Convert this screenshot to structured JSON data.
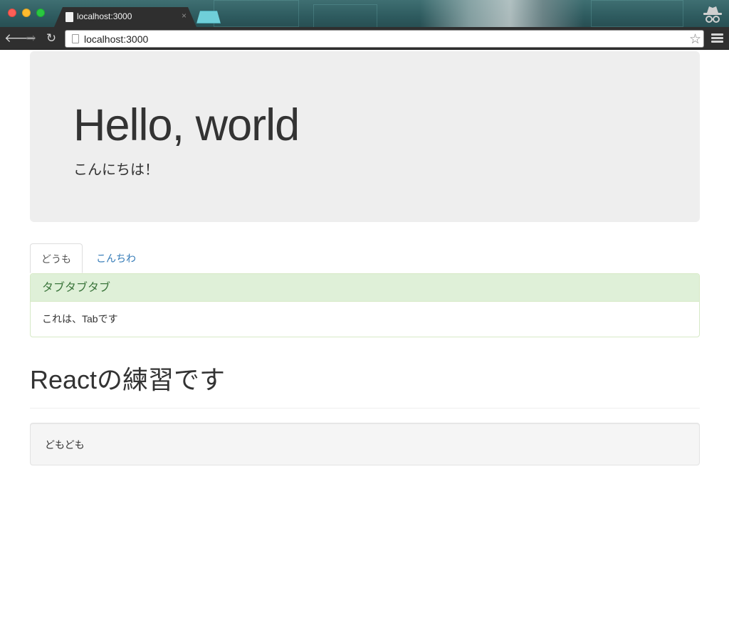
{
  "browser": {
    "tab_title": "localhost:3000",
    "tab_close": "×",
    "url": "localhost:3000",
    "icons": {
      "back": "arrow-left-icon",
      "forward": "arrow-right-icon",
      "reload": "reload-icon",
      "star": "star-icon",
      "menu": "hamburger-menu-icon",
      "incognito": "incognito-icon"
    },
    "glyphs": {
      "back": "🡐",
      "forward": "⇨",
      "reload": "↻",
      "star": "☆"
    },
    "colors": {
      "titlebar": "#2e5b5f",
      "toolbar": "#2f2f2f",
      "new_tab": "#6fcfd9"
    }
  },
  "jumbotron": {
    "heading": "Hello, world",
    "subheading": "こんにちは！"
  },
  "tabs": [
    {
      "label": "どうも",
      "active": true
    },
    {
      "label": "こんちわ",
      "active": false
    }
  ],
  "panel": {
    "heading": "タブタブタブ",
    "body": "これは、Tabです"
  },
  "page_header": {
    "title": "Reactの練習です"
  },
  "well": {
    "text": "どもども"
  },
  "colors": {
    "link": "#337ab7",
    "panel_success_bg": "#dff0d8",
    "panel_success_text": "#3c763d",
    "jumbotron_bg": "#eeeeee"
  }
}
